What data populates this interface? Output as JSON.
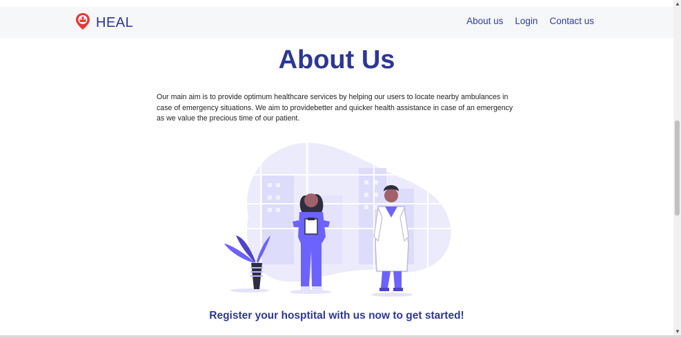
{
  "brand": {
    "name": "HEAL",
    "icon": "heal-logo-icon"
  },
  "nav": {
    "items": [
      {
        "label": "About us"
      },
      {
        "label": "Login"
      },
      {
        "label": "Contact us"
      }
    ]
  },
  "page": {
    "title": "About Us",
    "description": "Our main aim is to provide optimum healthcare services by helping our users to locate nearby ambulances in case of emergency situations. We aim to providebetter and quicker health assistance in case of an emergency as we value the precious time of our patient.",
    "cta": "Register your hosptital with us now to get started!"
  },
  "illustration": {
    "name": "doctors-illustration"
  },
  "colors": {
    "brand": "#2d3893",
    "accent": "#6c63ff",
    "logo_red": "#e53935",
    "navbar_bg": "#f6f7f8"
  }
}
